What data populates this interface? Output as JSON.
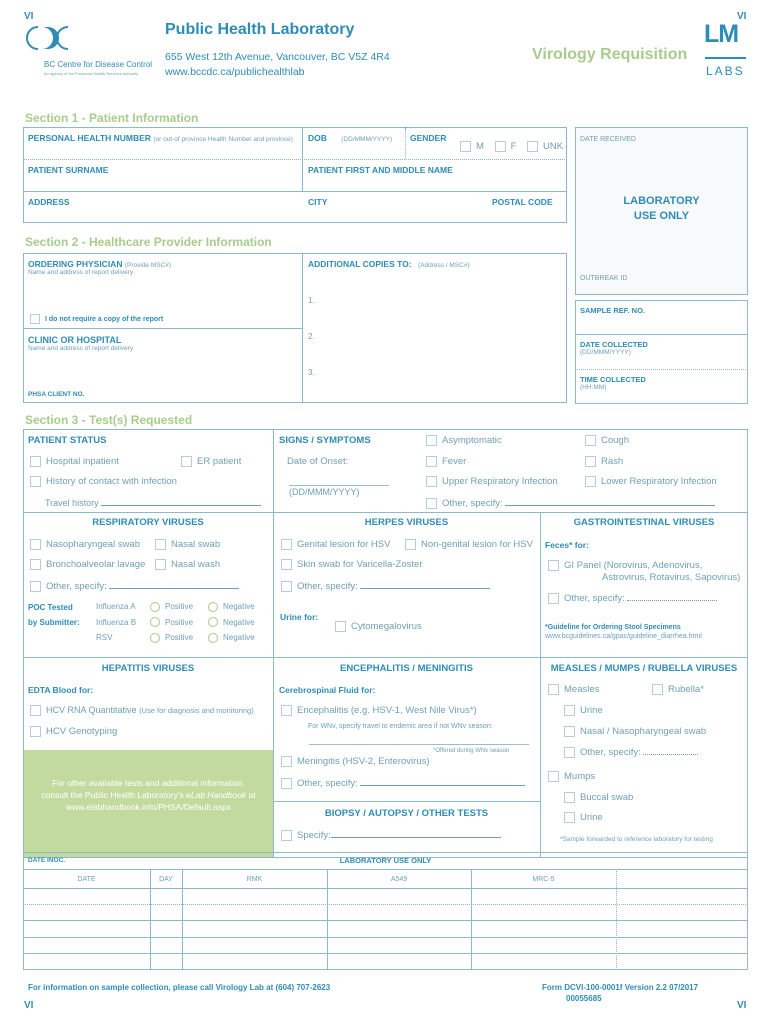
{
  "header": {
    "corner_mark": "VI",
    "org_name": "BC Centre for Disease Control",
    "org_sub": "An agency of the Provincial Health Services Authority",
    "lab_title": "Public Health Laboratory",
    "address": "655 West 12th Avenue, Vancouver, BC V5Z 4R4",
    "website": "www.bccdc.ca/publichealthlab",
    "form_title": "Virology Requisition",
    "lm_logo": "LM",
    "labs_logo": "LABS",
    "colors": {
      "primary": "#2e8cb5",
      "accent_green": "#a8cc8c",
      "panel_green": "#c3da9f"
    }
  },
  "section1": {
    "title": "Section 1 - Patient Information",
    "phn_label": "PERSONAL HEALTH NUMBER",
    "phn_note": "(or out-of province Health Number and province)",
    "dob_label": "DOB",
    "dob_format": "(DD/MMM/YYYY)",
    "gender_label": "GENDER",
    "gender_options": [
      "M",
      "F",
      "UNK"
    ],
    "surname_label": "PATIENT SURNAME",
    "firstname_label": "PATIENT FIRST AND MIDDLE NAME",
    "address_label": "ADDRESS",
    "city_label": "CITY",
    "postal_label": "POSTAL CODE"
  },
  "lab_box": {
    "date_received": "DATE RECEIVED",
    "lab_use_line1": "LABORATORY",
    "lab_use_line2": "USE ONLY",
    "outbreak_id": "OUTBREAK ID",
    "sample_ref": "SAMPLE REF.  NO.",
    "date_collected": "DATE COLLECTED",
    "date_collected_format": "(DD/MMM/YYYY)",
    "time_collected": "TIME COLLECTED",
    "time_collected_format": "(HH:MM)"
  },
  "section2": {
    "title": "Section 2 - Healthcare Provider Information",
    "ordering_label": "ORDERING PHYSICIAN",
    "ordering_note": "(Provide MSC#)",
    "ordering_sub": "Name and address of report delivery",
    "no_copy": "I do not require a copy of the report",
    "clinic_label": "CLINIC OR HOSPITAL",
    "clinic_sub": "Name and address of report delivery",
    "phsa_label": "PHSA CLIENT NO.",
    "copies_label": "ADDITIONAL COPIES TO:",
    "copies_note": "(Address / MSC#)",
    "copies": [
      "1.",
      "2.",
      "3."
    ]
  },
  "section3": {
    "title": "Section 3 - Test(s) Requested",
    "patient_status": {
      "label": "PATIENT STATUS",
      "hospital_inpatient": "Hospital inpatient",
      "er_patient": "ER patient",
      "contact": "History of contact with infection",
      "travel": "Travel history"
    },
    "signs": {
      "label": "SIGNS / SYMPTOMS",
      "onset": "Date of Onset:",
      "onset_format": "(DD/MMM/YYYY)",
      "items": [
        "Asymptomatic",
        "Cough",
        "Fever",
        "Rash",
        "Upper Respiratory Infection",
        "Lower Respiratory Infection"
      ],
      "other": "Other, specify:"
    },
    "respiratory": {
      "header": "RESPIRATORY VIRUSES",
      "items": [
        "Nasopharyngeal swab",
        "Nasal swab",
        "Bronchoalveolar lavage",
        "Nasal wash"
      ],
      "other": "Other, specify:",
      "poc_line1": "POC Tested",
      "poc_line2": "by Submitter:",
      "poc_tests": [
        "Influenza A",
        "Influenza B",
        "RSV"
      ],
      "positive": "Positive",
      "negative": "Negative"
    },
    "herpes": {
      "header": "HERPES VIRUSES",
      "genital": "Genital lesion for HSV",
      "nongenital": "Non-genital lesion for HSV",
      "skin": "Skin swab for Varicella-Zoster",
      "other": "Other, specify:",
      "urine_label": "Urine for:",
      "cmv": "Cytomegalovirus"
    },
    "gi": {
      "header": "GASTROINTESTINAL VIRUSES",
      "feces_label": "Feces* for:",
      "panel_line1": "GI Panel (Norovirus, Adenovirus,",
      "panel_line2": "Astrovirus, Rotavirus, Sapovirus)",
      "other": "Other, specify:",
      "guideline": "*Guideline for Ordering Stool Specimens",
      "guideline_url": "www.bcguidelines.ca/gpac/guideline_diarrhea.html"
    },
    "hepatitis": {
      "header": "HEPATITIS VIRUSES",
      "edta_label": "EDTA Blood for:",
      "hcv_rna": "HCV RNA Quantitative",
      "hcv_rna_note": "(Use for diagnosis and monitoring)",
      "hcv_geno": "HCV Genotyping"
    },
    "info_panel": {
      "line1": "For other available tests and additional information,",
      "line2a": "consult the Public Health Laboratory's ",
      "line2b": "eLab Handbook",
      "line2c": " at",
      "line3": "www.elabhandbook.info/PHSA/Default.aspx"
    },
    "encephalitis": {
      "header": "ENCEPHALITIS / MENINGITIS",
      "csf_label": "Cerebrospinal Fluid for:",
      "enceph": "Encephalitis (e.g. HSV-1, West Nile Virus*)",
      "wnv_note": "For WNv, specify travel to endemic area if not WNv season:",
      "wnv_offered": "*Offered during WNv season",
      "meningitis": "Meningitis (HSV-2, Enterovirus)",
      "other": "Other, specify:"
    },
    "biopsy": {
      "header": "BIOPSY / AUTOPSY / OTHER TESTS",
      "specify": "Specify:"
    },
    "mmr": {
      "header": "MEASLES / MUMPS / RUBELLA VIRUSES",
      "measles": "Measles",
      "rubella": "Rubella*",
      "urine": "Urine",
      "nasal": "Nasal / Nasopharyngeal swab",
      "other": "Other, specify:",
      "mumps": "Mumps",
      "buccal": "Buccal swab",
      "urine2": "Urine",
      "note": "*Sample forwarded to reference laboratory for testing"
    }
  },
  "lab_table": {
    "date_inoc": "DATE INOC.",
    "title": "LABORATORY USE ONLY",
    "columns": [
      "DATE",
      "DAY",
      "RMK",
      "A549",
      "MRC-5",
      ""
    ]
  },
  "footer": {
    "info": "For information on sample collection, please call Virology Lab at (604) 707-2623",
    "form_no": "Form DCVI-100-0001f Version 2.2 07/2017",
    "serial": "00055685",
    "corner_mark": "VI"
  }
}
